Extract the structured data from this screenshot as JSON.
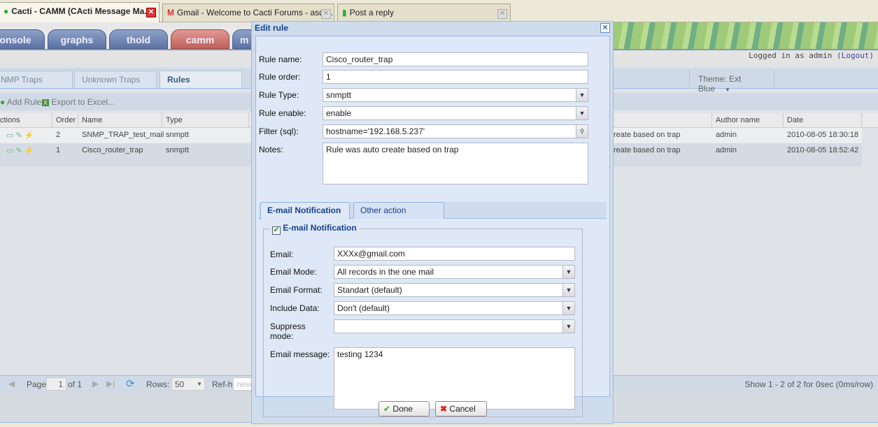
{
  "browser": {
    "tabs": [
      {
        "title": "Cacti - CAMM (CActi Message Ma..."
      },
      {
        "title": "Gmail - Welcome to Cacti Forums - asdf..."
      },
      {
        "title": "Post a reply"
      }
    ]
  },
  "cacti": {
    "tabs": [
      "onsole",
      "graphs",
      "thold",
      "camm",
      "m"
    ],
    "login_text": "Logged in as admin (",
    "logout": "Logout",
    "login_end": ")"
  },
  "panel": {
    "tabs": [
      "NMP Traps",
      "Unknown Traps",
      "Rules"
    ],
    "theme": "Theme: Ext Blue"
  },
  "toolbar": {
    "add_rule": "Add Rule",
    "export": "Export to Excel..."
  },
  "grid": {
    "headers": [
      "ctions",
      "Order",
      "Name",
      "Type",
      "Author name",
      "Date"
    ],
    "rows": [
      {
        "order": "2",
        "name": "SNMP_TRAP_test_mail",
        "type": "snmptt",
        "notes": "reate based on trap",
        "author": "admin",
        "date": "2010-08-05 18:30:18"
      },
      {
        "order": "1",
        "name": "Cisco_router_trap",
        "type": "snmptt",
        "notes": "reate based on trap",
        "author": "admin",
        "date": "2010-08-05 18:52:42"
      }
    ]
  },
  "pager": {
    "page_label": "Page",
    "page": "1",
    "of": "of 1",
    "rows_label": "Rows:",
    "rows": "50",
    "refresh_label": "Ref-h",
    "refresh_value": "neve",
    "summary": "Show 1 - 2 of 2 for 0sec (0ms/row)"
  },
  "dialog": {
    "title": "Edit rule",
    "fields": {
      "rule_name": {
        "label": "Rule name:",
        "value": "Cisco_router_trap"
      },
      "rule_order": {
        "label": "Rule order:",
        "value": "1"
      },
      "rule_type": {
        "label": "Rule Type:",
        "value": "snmptt"
      },
      "rule_enable": {
        "label": "Rule enable:",
        "value": "enable"
      },
      "filter": {
        "label": "Filter (sql):",
        "value": "hostname='192.168.5.237'"
      },
      "notes": {
        "label": "Notes:",
        "value": "Rule was auto create based on trap"
      }
    },
    "tabs": [
      "E-mail Notification",
      "Other action"
    ],
    "email_section": {
      "legend": "E-mail Notification",
      "checked": true,
      "email": {
        "label": "Email:",
        "value": "XXXx@gmail.com"
      },
      "mode": {
        "label": "Email Mode:",
        "value": "All records in the one mail"
      },
      "format": {
        "label": "Email Format:",
        "value": "Standart (default)"
      },
      "include": {
        "label": "Include Data:",
        "value": "Don't (default)"
      },
      "suppress": {
        "label": "Suppress mode:",
        "value": ""
      },
      "message": {
        "label": "Email message:",
        "value": "testing 1234"
      }
    },
    "done": "Done",
    "cancel": "Cancel"
  }
}
